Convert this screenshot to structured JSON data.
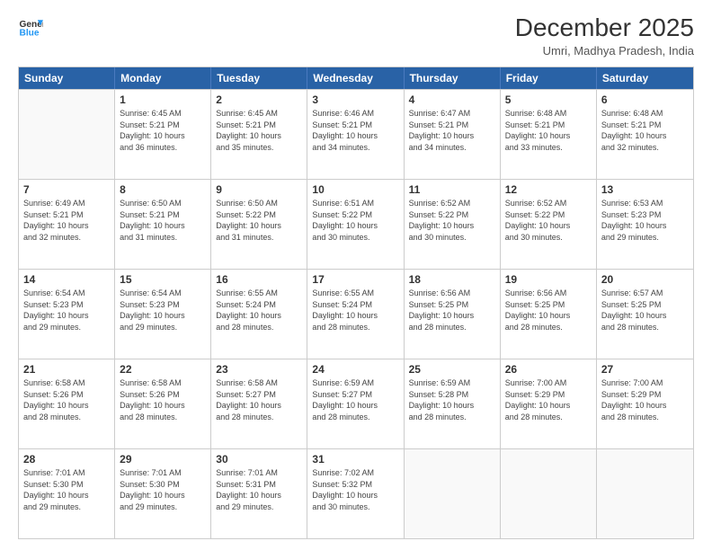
{
  "logo": {
    "line1": "General",
    "line2": "Blue"
  },
  "title": "December 2025",
  "subtitle": "Umri, Madhya Pradesh, India",
  "header_days": [
    "Sunday",
    "Monday",
    "Tuesday",
    "Wednesday",
    "Thursday",
    "Friday",
    "Saturday"
  ],
  "weeks": [
    [
      {
        "day": "",
        "info": ""
      },
      {
        "day": "1",
        "info": "Sunrise: 6:45 AM\nSunset: 5:21 PM\nDaylight: 10 hours\nand 36 minutes."
      },
      {
        "day": "2",
        "info": "Sunrise: 6:45 AM\nSunset: 5:21 PM\nDaylight: 10 hours\nand 35 minutes."
      },
      {
        "day": "3",
        "info": "Sunrise: 6:46 AM\nSunset: 5:21 PM\nDaylight: 10 hours\nand 34 minutes."
      },
      {
        "day": "4",
        "info": "Sunrise: 6:47 AM\nSunset: 5:21 PM\nDaylight: 10 hours\nand 34 minutes."
      },
      {
        "day": "5",
        "info": "Sunrise: 6:48 AM\nSunset: 5:21 PM\nDaylight: 10 hours\nand 33 minutes."
      },
      {
        "day": "6",
        "info": "Sunrise: 6:48 AM\nSunset: 5:21 PM\nDaylight: 10 hours\nand 32 minutes."
      }
    ],
    [
      {
        "day": "7",
        "info": "Sunrise: 6:49 AM\nSunset: 5:21 PM\nDaylight: 10 hours\nand 32 minutes."
      },
      {
        "day": "8",
        "info": "Sunrise: 6:50 AM\nSunset: 5:21 PM\nDaylight: 10 hours\nand 31 minutes."
      },
      {
        "day": "9",
        "info": "Sunrise: 6:50 AM\nSunset: 5:22 PM\nDaylight: 10 hours\nand 31 minutes."
      },
      {
        "day": "10",
        "info": "Sunrise: 6:51 AM\nSunset: 5:22 PM\nDaylight: 10 hours\nand 30 minutes."
      },
      {
        "day": "11",
        "info": "Sunrise: 6:52 AM\nSunset: 5:22 PM\nDaylight: 10 hours\nand 30 minutes."
      },
      {
        "day": "12",
        "info": "Sunrise: 6:52 AM\nSunset: 5:22 PM\nDaylight: 10 hours\nand 30 minutes."
      },
      {
        "day": "13",
        "info": "Sunrise: 6:53 AM\nSunset: 5:23 PM\nDaylight: 10 hours\nand 29 minutes."
      }
    ],
    [
      {
        "day": "14",
        "info": "Sunrise: 6:54 AM\nSunset: 5:23 PM\nDaylight: 10 hours\nand 29 minutes."
      },
      {
        "day": "15",
        "info": "Sunrise: 6:54 AM\nSunset: 5:23 PM\nDaylight: 10 hours\nand 29 minutes."
      },
      {
        "day": "16",
        "info": "Sunrise: 6:55 AM\nSunset: 5:24 PM\nDaylight: 10 hours\nand 28 minutes."
      },
      {
        "day": "17",
        "info": "Sunrise: 6:55 AM\nSunset: 5:24 PM\nDaylight: 10 hours\nand 28 minutes."
      },
      {
        "day": "18",
        "info": "Sunrise: 6:56 AM\nSunset: 5:25 PM\nDaylight: 10 hours\nand 28 minutes."
      },
      {
        "day": "19",
        "info": "Sunrise: 6:56 AM\nSunset: 5:25 PM\nDaylight: 10 hours\nand 28 minutes."
      },
      {
        "day": "20",
        "info": "Sunrise: 6:57 AM\nSunset: 5:25 PM\nDaylight: 10 hours\nand 28 minutes."
      }
    ],
    [
      {
        "day": "21",
        "info": "Sunrise: 6:58 AM\nSunset: 5:26 PM\nDaylight: 10 hours\nand 28 minutes."
      },
      {
        "day": "22",
        "info": "Sunrise: 6:58 AM\nSunset: 5:26 PM\nDaylight: 10 hours\nand 28 minutes."
      },
      {
        "day": "23",
        "info": "Sunrise: 6:58 AM\nSunset: 5:27 PM\nDaylight: 10 hours\nand 28 minutes."
      },
      {
        "day": "24",
        "info": "Sunrise: 6:59 AM\nSunset: 5:27 PM\nDaylight: 10 hours\nand 28 minutes."
      },
      {
        "day": "25",
        "info": "Sunrise: 6:59 AM\nSunset: 5:28 PM\nDaylight: 10 hours\nand 28 minutes."
      },
      {
        "day": "26",
        "info": "Sunrise: 7:00 AM\nSunset: 5:29 PM\nDaylight: 10 hours\nand 28 minutes."
      },
      {
        "day": "27",
        "info": "Sunrise: 7:00 AM\nSunset: 5:29 PM\nDaylight: 10 hours\nand 28 minutes."
      }
    ],
    [
      {
        "day": "28",
        "info": "Sunrise: 7:01 AM\nSunset: 5:30 PM\nDaylight: 10 hours\nand 29 minutes."
      },
      {
        "day": "29",
        "info": "Sunrise: 7:01 AM\nSunset: 5:30 PM\nDaylight: 10 hours\nand 29 minutes."
      },
      {
        "day": "30",
        "info": "Sunrise: 7:01 AM\nSunset: 5:31 PM\nDaylight: 10 hours\nand 29 minutes."
      },
      {
        "day": "31",
        "info": "Sunrise: 7:02 AM\nSunset: 5:32 PM\nDaylight: 10 hours\nand 30 minutes."
      },
      {
        "day": "",
        "info": ""
      },
      {
        "day": "",
        "info": ""
      },
      {
        "day": "",
        "info": ""
      }
    ]
  ]
}
